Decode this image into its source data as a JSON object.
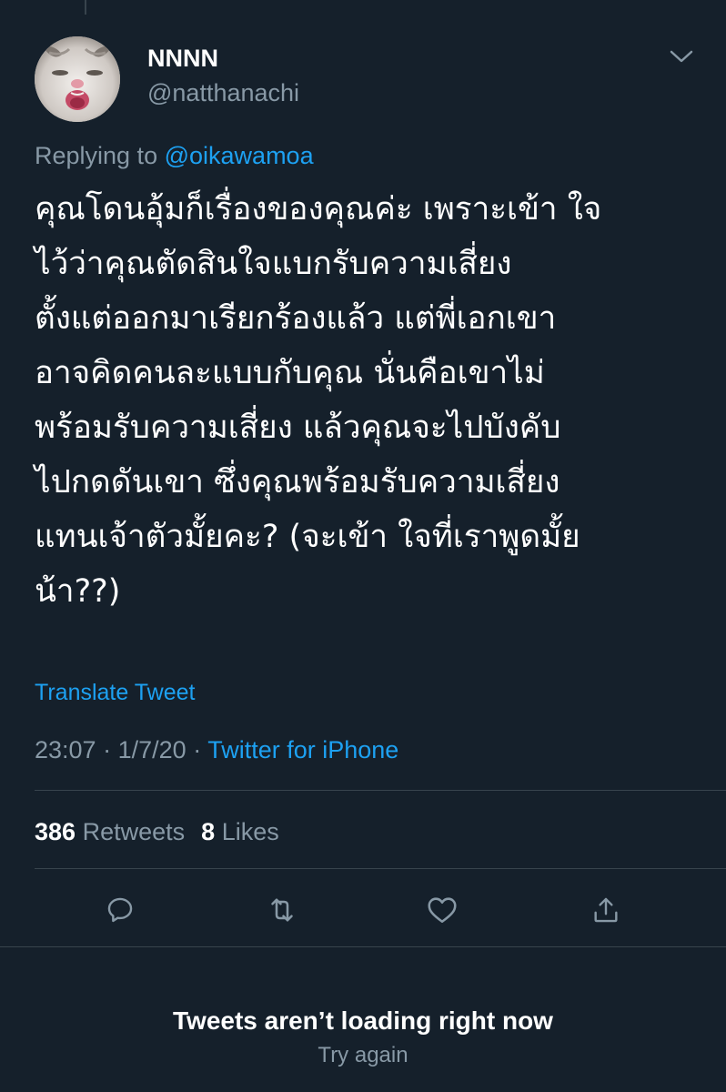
{
  "author": {
    "display_name": "NNNN",
    "handle": "@natthanachi"
  },
  "reply": {
    "prefix": "Replying to",
    "mention": "@oikawamoa"
  },
  "tweet": {
    "text": "คุณโดนอุ้มก็เรื่องของคุณค่ะ เพราะเข้า ใจ\nไว้ว่าคุณตัดสินใจแบกรับความเสี่ยง\nตั้งแต่ออกมาเรียกร้องแล้ว แต่พี่เอกเขา\nอาจคิดคนละแบบกับคุณ นั่นคือเขาไม่\nพร้อมรับความเสี่ยง แล้วคุณจะไปบังคับ\nไปกดดันเขา ซึ่งคุณพร้อมรับความเสี่ยง\nแทนเจ้าตัวมั้ยคะ? (จะเข้า ใจที่เราพูดมั้ย\nน้า??)",
    "translate_label": "Translate Tweet",
    "time": "23:07",
    "date": "1/7/20",
    "separator": "·",
    "source": "Twitter for iPhone"
  },
  "stats": {
    "retweets_count": "386",
    "retweets_label": "Retweets",
    "likes_count": "8",
    "likes_label": "Likes"
  },
  "actions": {
    "icons": [
      "reply-icon",
      "retweet-icon",
      "like-icon",
      "share-icon"
    ]
  },
  "status": {
    "message": "Tweets aren’t loading right now",
    "retry_label": "Try again"
  },
  "colors": {
    "background": "#15202b",
    "accent": "#1da1f2",
    "secondary_text": "#8899a6",
    "divider": "#38444d"
  }
}
